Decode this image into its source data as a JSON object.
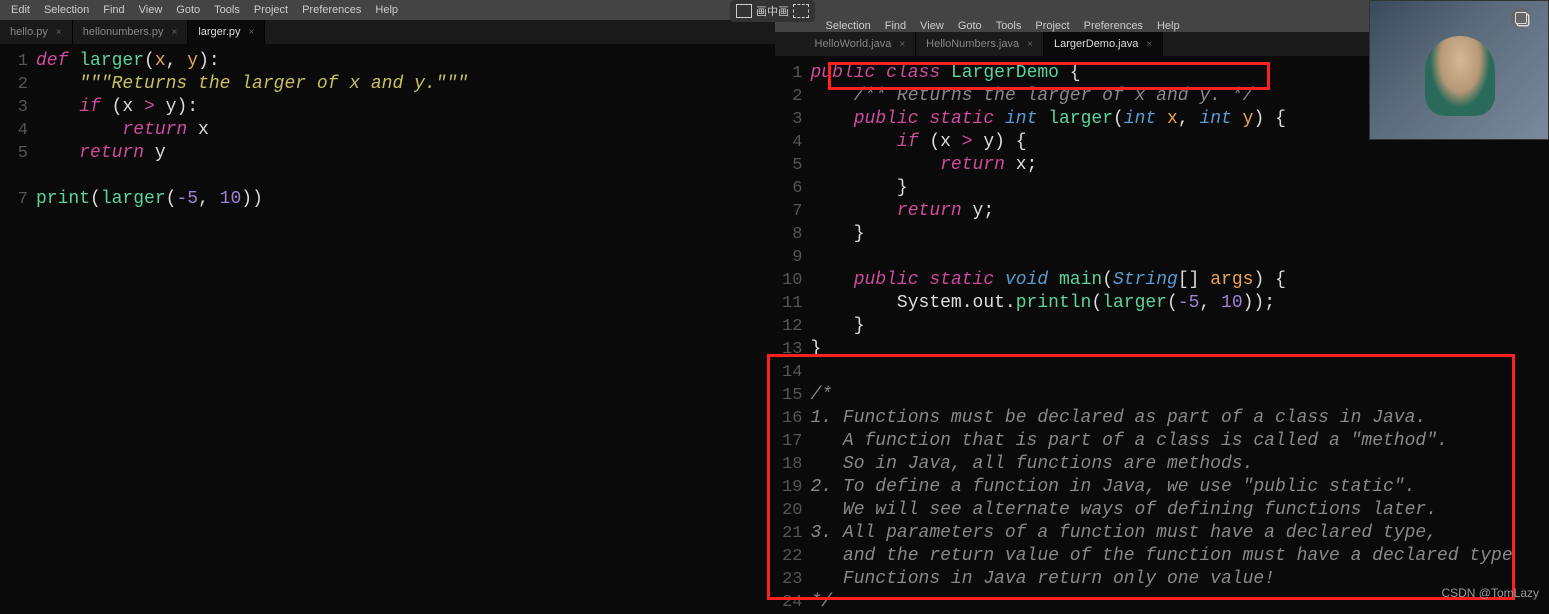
{
  "menubar_left": [
    "Edit",
    "Selection",
    "Find",
    "View",
    "Goto",
    "Tools",
    "Project",
    "Preferences",
    "Help"
  ],
  "menubar_right": [
    "Selection",
    "Find",
    "View",
    "Goto",
    "Tools",
    "Project",
    "Preferences",
    "Help"
  ],
  "tabs_left": [
    {
      "label": "hello.py",
      "active": false
    },
    {
      "label": "hellonumbers.py",
      "active": false
    },
    {
      "label": "larger.py",
      "active": true
    }
  ],
  "tabs_right": [
    {
      "label": "HelloWorld.java",
      "active": false
    },
    {
      "label": "HelloNumbers.java",
      "active": false
    },
    {
      "label": "LargerDemo.java",
      "active": true
    }
  ],
  "pip_label": "画中画",
  "watermark": "CSDN @TomLazy",
  "left_code": {
    "lines": [
      {
        "n": "1",
        "tokens": [
          {
            "t": "def ",
            "c": "kw"
          },
          {
            "t": "larger",
            "c": "fn"
          },
          {
            "t": "(",
            "c": "punct"
          },
          {
            "t": "x",
            "c": "param"
          },
          {
            "t": ", ",
            "c": "punct"
          },
          {
            "t": "y",
            "c": "param"
          },
          {
            "t": "):",
            "c": "punct"
          }
        ]
      },
      {
        "n": "2",
        "tokens": [
          {
            "t": "    ",
            "c": ""
          },
          {
            "t": "\"\"\"Returns the larger of x and y.\"\"\"",
            "c": "str"
          }
        ]
      },
      {
        "n": "3",
        "tokens": [
          {
            "t": "    ",
            "c": ""
          },
          {
            "t": "if",
            "c": "kw"
          },
          {
            "t": " (x ",
            "c": "punct"
          },
          {
            "t": ">",
            "c": "kw"
          },
          {
            "t": " y):",
            "c": "punct"
          }
        ]
      },
      {
        "n": "4",
        "tokens": [
          {
            "t": "        ",
            "c": ""
          },
          {
            "t": "return",
            "c": "kw"
          },
          {
            "t": " x",
            "c": "punct"
          }
        ]
      },
      {
        "n": "5",
        "tokens": [
          {
            "t": "    ",
            "c": ""
          },
          {
            "t": "return",
            "c": "kw"
          },
          {
            "t": " y",
            "c": "punct"
          }
        ]
      },
      {
        "n": "",
        "tokens": []
      },
      {
        "n": "7",
        "tokens": [
          {
            "t": "print",
            "c": "fn"
          },
          {
            "t": "(",
            "c": "punct"
          },
          {
            "t": "larger",
            "c": "fn"
          },
          {
            "t": "(",
            "c": "punct"
          },
          {
            "t": "-5",
            "c": "num"
          },
          {
            "t": ", ",
            "c": "punct"
          },
          {
            "t": "10",
            "c": "num"
          },
          {
            "t": "))",
            "c": "punct"
          }
        ]
      }
    ]
  },
  "right_code": {
    "lines": [
      {
        "n": "1",
        "tokens": [
          {
            "t": "public",
            "c": "kw"
          },
          {
            "t": " ",
            "c": ""
          },
          {
            "t": "class",
            "c": "kw2"
          },
          {
            "t": " ",
            "c": ""
          },
          {
            "t": "LargerDemo",
            "c": "fn"
          },
          {
            "t": " {",
            "c": "punct"
          }
        ]
      },
      {
        "n": "2",
        "tokens": [
          {
            "t": "    ",
            "c": ""
          },
          {
            "t": "/** Returns the larger of x and y. */",
            "c": "com"
          }
        ]
      },
      {
        "n": "3",
        "tokens": [
          {
            "t": "    ",
            "c": ""
          },
          {
            "t": "public",
            "c": "kw"
          },
          {
            "t": " ",
            "c": ""
          },
          {
            "t": "static",
            "c": "kw"
          },
          {
            "t": " ",
            "c": ""
          },
          {
            "t": "int",
            "c": "type"
          },
          {
            "t": " ",
            "c": ""
          },
          {
            "t": "larger",
            "c": "fn"
          },
          {
            "t": "(",
            "c": "punct"
          },
          {
            "t": "int",
            "c": "type"
          },
          {
            "t": " ",
            "c": ""
          },
          {
            "t": "x",
            "c": "param"
          },
          {
            "t": ", ",
            "c": "punct"
          },
          {
            "t": "int",
            "c": "type"
          },
          {
            "t": " ",
            "c": ""
          },
          {
            "t": "y",
            "c": "param"
          },
          {
            "t": ") {",
            "c": "punct"
          }
        ]
      },
      {
        "n": "4",
        "tokens": [
          {
            "t": "        ",
            "c": ""
          },
          {
            "t": "if",
            "c": "kw"
          },
          {
            "t": " (x ",
            "c": "punct"
          },
          {
            "t": ">",
            "c": "kw"
          },
          {
            "t": " y) {",
            "c": "punct"
          }
        ]
      },
      {
        "n": "5",
        "tokens": [
          {
            "t": "            ",
            "c": ""
          },
          {
            "t": "return",
            "c": "kw"
          },
          {
            "t": " x;",
            "c": "punct"
          }
        ]
      },
      {
        "n": "6",
        "tokens": [
          {
            "t": "        }",
            "c": "punct"
          }
        ]
      },
      {
        "n": "7",
        "tokens": [
          {
            "t": "        ",
            "c": ""
          },
          {
            "t": "return",
            "c": "kw"
          },
          {
            "t": " y;",
            "c": "punct"
          }
        ]
      },
      {
        "n": "8",
        "tokens": [
          {
            "t": "    }",
            "c": "punct"
          }
        ]
      },
      {
        "n": "9",
        "tokens": []
      },
      {
        "n": "10",
        "tokens": [
          {
            "t": "    ",
            "c": ""
          },
          {
            "t": "public",
            "c": "kw"
          },
          {
            "t": " ",
            "c": ""
          },
          {
            "t": "static",
            "c": "kw"
          },
          {
            "t": " ",
            "c": ""
          },
          {
            "t": "void",
            "c": "type"
          },
          {
            "t": " ",
            "c": ""
          },
          {
            "t": "main",
            "c": "fn"
          },
          {
            "t": "(",
            "c": "punct"
          },
          {
            "t": "String",
            "c": "type"
          },
          {
            "t": "[] ",
            "c": "punct"
          },
          {
            "t": "args",
            "c": "param"
          },
          {
            "t": ") {",
            "c": "punct"
          }
        ]
      },
      {
        "n": "11",
        "tokens": [
          {
            "t": "        System.out.",
            "c": "punct"
          },
          {
            "t": "println",
            "c": "fn"
          },
          {
            "t": "(",
            "c": "punct"
          },
          {
            "t": "larger",
            "c": "fn"
          },
          {
            "t": "(",
            "c": "punct"
          },
          {
            "t": "-5",
            "c": "num"
          },
          {
            "t": ", ",
            "c": "punct"
          },
          {
            "t": "10",
            "c": "num"
          },
          {
            "t": "));",
            "c": "punct"
          }
        ]
      },
      {
        "n": "12",
        "tokens": [
          {
            "t": "    }",
            "c": "punct"
          }
        ]
      },
      {
        "n": "13",
        "tokens": [
          {
            "t": "}",
            "c": "punct"
          }
        ]
      },
      {
        "n": "14",
        "tokens": []
      },
      {
        "n": "15",
        "tokens": [
          {
            "t": "/*",
            "c": "com"
          }
        ]
      },
      {
        "n": "16",
        "tokens": [
          {
            "t": "1. Functions must be declared as part of a class in Java.",
            "c": "com"
          }
        ]
      },
      {
        "n": "17",
        "tokens": [
          {
            "t": "   A function that is part of a class is called a \"method\".",
            "c": "com"
          }
        ]
      },
      {
        "n": "18",
        "tokens": [
          {
            "t": "   So in Java, all functions are methods.",
            "c": "com"
          }
        ]
      },
      {
        "n": "19",
        "tokens": [
          {
            "t": "2. To define a function in Java, we use \"public static\".",
            "c": "com"
          }
        ]
      },
      {
        "n": "20",
        "tokens": [
          {
            "t": "   We will see alternate ways of defining functions later.",
            "c": "com"
          }
        ]
      },
      {
        "n": "21",
        "tokens": [
          {
            "t": "3. All parameters of a function must have a declared type,",
            "c": "com"
          }
        ]
      },
      {
        "n": "22",
        "tokens": [
          {
            "t": "   and the return value of the function must have a declared type",
            "c": "com"
          }
        ]
      },
      {
        "n": "23",
        "tokens": [
          {
            "t": "   Functions in Java return only one value!",
            "c": "com"
          }
        ]
      },
      {
        "n": "24",
        "tokens": [
          {
            "t": "*/",
            "c": "com"
          }
        ]
      }
    ]
  }
}
